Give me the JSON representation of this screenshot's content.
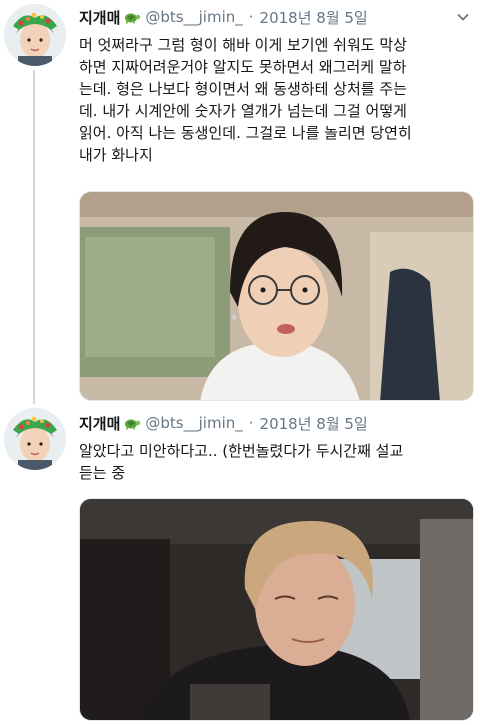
{
  "tweets": [
    {
      "display_name": "지개매",
      "handle": "@bts__jimin_",
      "separator": "·",
      "date": "2018년 8월 5일",
      "text": "머 엇쩌라구 그럼 형이 해바 이게 보기엔 쉬워도 막상\n하면 지짜어려운거야 알지도 못하면서 왜그러케 말하\n는데. 형은 나보다 형이면서 왜 동생하테 상처를 주는\n데. 내가 시계안에 숫자가 열개가 넘는데 그걸 어떻게\n읽어. 아직 나는 동생인데. 그걸로 나를 놀리면 당연히\n내가 화나지",
      "icons": {
        "badge": "turtle-emoji",
        "menu": "chevron-down-icon"
      }
    },
    {
      "display_name": "지개매",
      "handle": "@bts__jimin_",
      "separator": "·",
      "date": "2018년 8월 5일",
      "text": "알았다고 미안하다고.. (한번놀렸다가 두시간째 설교\n듣는 중",
      "icons": {
        "badge": "turtle-emoji",
        "menu": "chevron-down-icon"
      }
    }
  ],
  "colors": {
    "secondary_text": "#657786",
    "thread_line": "#cfd9de",
    "primary_text": "#14171a"
  }
}
